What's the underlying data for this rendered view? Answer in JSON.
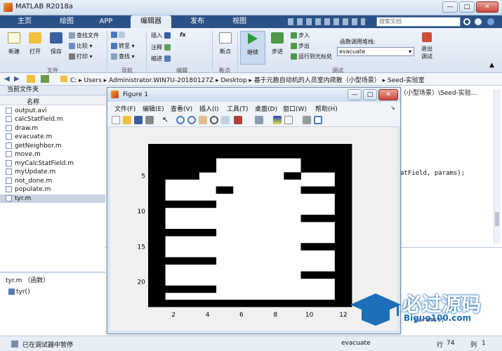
{
  "window": {
    "title": "MATLAB R2018a",
    "controls": [
      "—",
      "□",
      "✕"
    ]
  },
  "tabs": [
    {
      "label": "主页",
      "active": false
    },
    {
      "label": "绘图",
      "active": false
    },
    {
      "label": "APP",
      "active": false
    },
    {
      "label": "编辑器",
      "active": true
    },
    {
      "label": "发布",
      "active": false
    },
    {
      "label": "视图",
      "active": false
    }
  ],
  "search": {
    "placeholder": "搜索文档"
  },
  "ribbon": {
    "file_group": {
      "new": "新建",
      "open": "打开",
      "save": "保存",
      "find_files": "查找文件",
      "compare": "比较",
      "print": "打印",
      "label": "文件"
    },
    "nav_group": {
      "goto": "转至",
      "find": "查找",
      "label": "导航"
    },
    "edit_group": {
      "insert": "插入",
      "comment": "注释",
      "indent": "缩进",
      "fx": "fx",
      "label": "编辑"
    },
    "breakpoint_group": {
      "breakpoint": "断点",
      "label": "断点"
    },
    "debug_group": {
      "continue": "继续",
      "step": "步进",
      "step_in": "步入",
      "step_out": "步出",
      "run_to_cursor": "运行到光标处",
      "stack_label": "函数调用堆栈:",
      "stack_value": "evacuate",
      "quit_debug_1": "退出",
      "quit_debug_2": "调试",
      "label": "调试"
    }
  },
  "address": {
    "crumbs": "C: ▸ Users ▸ Administrator.WIN7U-20180127Z ▸ Desktop ▸ 基于元胞自动机的人员室内疏散（小型场景） ▸ Seed-实验室"
  },
  "current_folder": {
    "title": "当前文件夹",
    "col_name": "名称",
    "files": [
      "output.avi",
      "calcStatField.m",
      "draw.m",
      "evacuate.m",
      "getNeighbor.m",
      "move.m",
      "myCalcStatField.m",
      "myUpdate.m",
      "not_done.m",
      "populate.m",
      "tyr.m"
    ],
    "selected": "tyr.m",
    "details_title": "tyr.m （函数）",
    "details_item": "tyr()"
  },
  "editor_peek": {
    "path_tail": "（小型场景）\\Seed-实验...",
    "code_tail": "atField, params);",
    "cmd_tail": "params);"
  },
  "status": {
    "text": "已在调试器中暂停",
    "func": "evacuate",
    "row_label": "行",
    "row": "74",
    "col_label": "列",
    "col": "1"
  },
  "figure": {
    "title": "Figure 1",
    "menu": [
      "文件(F)",
      "编辑(E)",
      "查看(V)",
      "插入(I)",
      "工具(T)",
      "桌面(D)",
      "窗口(W)",
      "帮助(H)"
    ]
  },
  "chart_data": {
    "type": "heatmap",
    "xlim": [
      0.5,
      12.5
    ],
    "ylim": [
      0.5,
      23.5
    ],
    "xticks": [
      2,
      4,
      6,
      8,
      10,
      12
    ],
    "yticks": [
      5,
      10,
      15,
      20
    ],
    "colors": {
      "occupied": "#000000",
      "empty": "#ffffff"
    },
    "rows": [
      "111111111111",
      "111111111111",
      "111100000111",
      "111100000111",
      "111000001001",
      "100000000001",
      "100010000111",
      "100000000001",
      "111100000001",
      "100000000001",
      "100000000111",
      "100000000001",
      "111100000001",
      "100000000001",
      "100000000111",
      "100000000001",
      "111100000001",
      "100000000001",
      "100000000111",
      "100000000001",
      "111100000001",
      "100000000001",
      "111111111111"
    ]
  },
  "watermark": {
    "text": "必过源码",
    "url": "Biguo100.com"
  }
}
